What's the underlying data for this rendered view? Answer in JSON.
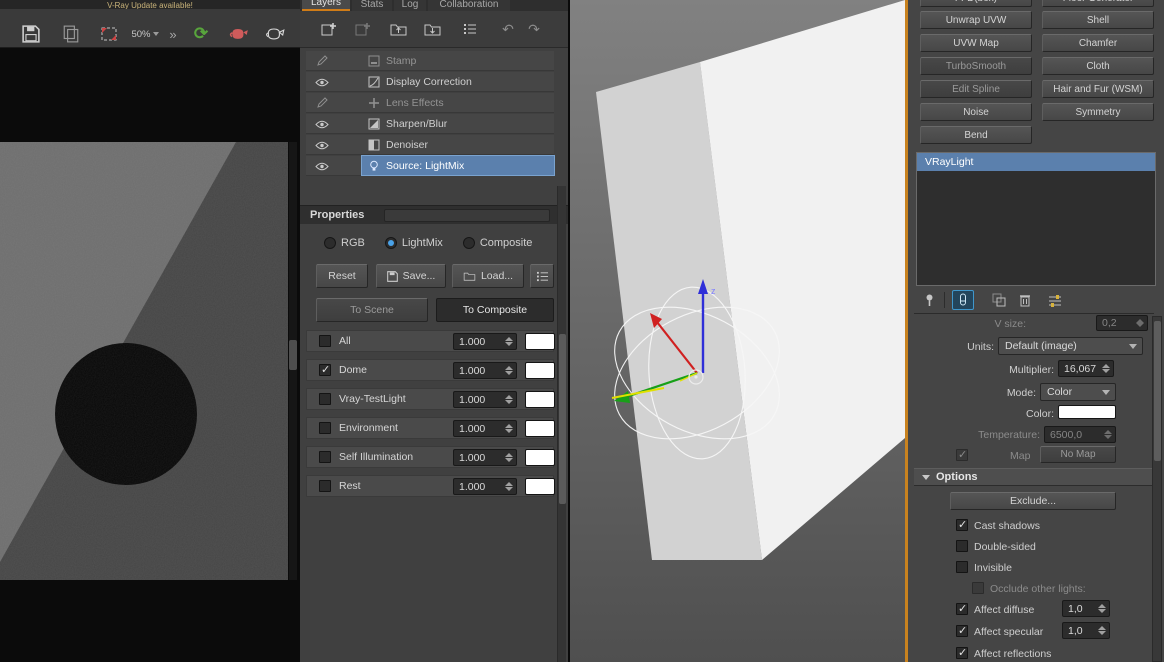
{
  "colors": {
    "accent_orange": "#c8821f",
    "selection_blue": "#5b80ad",
    "axis_x_red": "#d02020",
    "axis_y_green": "#18a018",
    "axis_z_blue": "#2f2fd8"
  },
  "vfb": {
    "banner": "V-Ray Update available!",
    "toolbar": {
      "zoom_label": "50%",
      "overflow_label": "»"
    }
  },
  "layers_panel": {
    "tabs": [
      {
        "label": "Layers"
      },
      {
        "label": "Stats"
      },
      {
        "label": "Log"
      },
      {
        "label": "Collaboration"
      }
    ],
    "layers": [
      {
        "label": "Stamp"
      },
      {
        "label": "Display Correction"
      },
      {
        "label": "Lens Effects"
      },
      {
        "label": "Sharpen/Blur"
      },
      {
        "label": "Denoiser"
      },
      {
        "label": "Source: LightMix"
      }
    ],
    "properties": {
      "title": "Properties",
      "modes": [
        {
          "label": "RGB"
        },
        {
          "label": "LightMix"
        },
        {
          "label": "Composite"
        }
      ],
      "reset_label": "Reset",
      "save_label": "Save...",
      "load_label": "Load...",
      "to_scene_label": "To Scene",
      "to_composite_label": "To Composite",
      "lights": [
        {
          "label": "All",
          "value": "1.000",
          "checked": false
        },
        {
          "label": "Dome",
          "value": "1.000",
          "checked": true
        },
        {
          "label": "Vray-TestLight",
          "value": "1.000",
          "checked": false
        },
        {
          "label": "Environment",
          "value": "1.000",
          "checked": false
        },
        {
          "label": "Self Illumination",
          "value": "1.000",
          "checked": false
        },
        {
          "label": "Rest",
          "value": "1.000",
          "checked": false
        }
      ]
    }
  },
  "viewport": {
    "axis_label": "z"
  },
  "command_panel": {
    "modifier_buttons": [
      {
        "label": "FFD(box)"
      },
      {
        "label": "Floor Generator"
      },
      {
        "label": "Unwrap UVW"
      },
      {
        "label": "Shell"
      },
      {
        "label": "UVW Map"
      },
      {
        "label": "Chamfer"
      },
      {
        "label": "TurboSmooth",
        "disabled": true
      },
      {
        "label": "Cloth"
      },
      {
        "label": "Edit Spline",
        "disabled": true
      },
      {
        "label": "Hair and Fur (WSM)"
      },
      {
        "label": "Noise"
      },
      {
        "label": "Symmetry"
      },
      {
        "label": "Bend"
      }
    ],
    "modifier_stack": [
      {
        "label": "VRayLight",
        "selected": true
      }
    ],
    "params": {
      "vsize_label": "V size:",
      "vsize_value": "0,2",
      "units_label": "Units:",
      "units_value": "Default (image)",
      "multiplier_label": "Multiplier:",
      "multiplier_value": "16,067",
      "mode_label": "Mode:",
      "mode_value": "Color",
      "color_label": "Color:",
      "temperature_label": "Temperature:",
      "temperature_value": "6500,0",
      "map_label": "Map",
      "map_button_label": "No Map"
    },
    "options": {
      "title": "Options",
      "exclude_label": "Exclude...",
      "cast_shadows_label": "Cast shadows",
      "double_sided_label": "Double-sided",
      "invisible_label": "Invisible",
      "occlude_label": "Occlude other lights:",
      "affect_diffuse_label": "Affect diffuse",
      "affect_diffuse_value": "1,0",
      "affect_specular_label": "Affect specular",
      "affect_specular_value": "1,0",
      "affect_reflections_label": "Affect reflections"
    }
  }
}
